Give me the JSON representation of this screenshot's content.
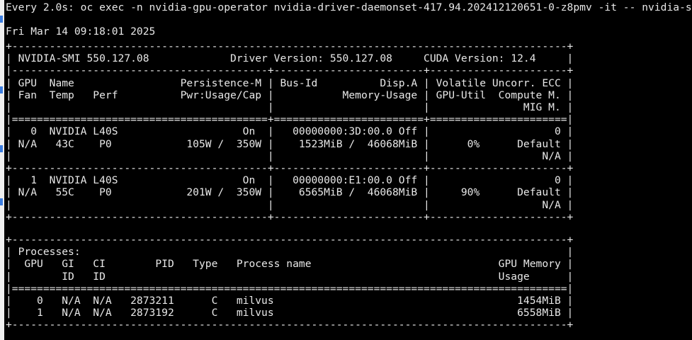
{
  "terminal": {
    "watch_header": "Every 2.0s: oc exec -n nvidia-gpu-operator nvidia-driver-daemonset-417.94.202412120651-0-z8pmv -it -- nvidia-smi",
    "timestamp": "Fri Mar 14 09:18:01 2025",
    "smi_table": [
      "+-----------------------------------------------------------------------------------------+",
      "| NVIDIA-SMI 550.127.08             Driver Version: 550.127.08     CUDA Version: 12.4     |",
      "|-----------------------------------------+------------------------+----------------------+",
      "| GPU  Name                 Persistence-M | Bus-Id          Disp.A | Volatile Uncorr. ECC |",
      "| Fan  Temp   Perf          Pwr:Usage/Cap |           Memory-Usage | GPU-Util  Compute M. |",
      "|                                         |                        |               MIG M. |",
      "|=========================================+========================+======================|",
      "|   0  NVIDIA L40S                    On  |   00000000:3D:00.0 Off |                    0 |",
      "| N/A   43C    P0            105W /  350W |    1523MiB /  46068MiB |      0%      Default |",
      "|                                         |                        |                  N/A |",
      "+-----------------------------------------+------------------------+----------------------+",
      "|   1  NVIDIA L40S                    On  |   00000000:E1:00.0 Off |                    0 |",
      "| N/A   55C    P0            201W /  350W |    6565MiB /  46068MiB |     90%      Default |",
      "|                                         |                        |                  N/A |",
      "+-----------------------------------------+------------------------+----------------------+"
    ],
    "proc_table": [
      "+-----------------------------------------------------------------------------------------+",
      "| Processes:                                                                              |",
      "|  GPU   GI   CI        PID   Type   Process name                              GPU Memory |",
      "|        ID   ID                                                               Usage      |",
      "|=========================================================================================|",
      "|    0   N/A  N/A   2873211      C   milvus                                       1454MiB |",
      "|    1   N/A  N/A   2873192      C   milvus                                       6558MiB |",
      "+-----------------------------------------------------------------------------------------+"
    ]
  },
  "colors": {
    "background": "#000000",
    "foreground": "#e8e8e8",
    "marker": "#3b7de0"
  }
}
